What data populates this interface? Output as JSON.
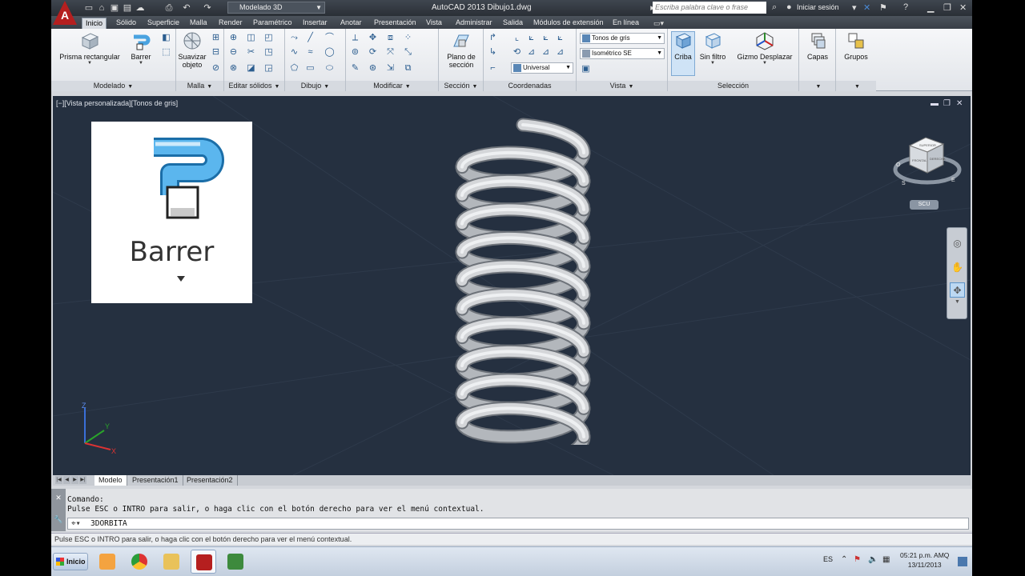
{
  "titlebar": {
    "workspace": "Modelado 3D",
    "title": "AutoCAD 2013    Dibujo1.dwg",
    "search_placeholder": "Escriba palabra clave o frase",
    "signin": "Iniciar sesión",
    "app_letter": "A"
  },
  "tabs": [
    "Inicio",
    "Sólido",
    "Superficie",
    "Malla",
    "Render",
    "Paramétrico",
    "Insertar",
    "Anotar",
    "Presentación",
    "Vista",
    "Administrar",
    "Salida",
    "Módulos de extensión",
    "En línea"
  ],
  "ribbon": {
    "panels": {
      "modelado": "Modelado",
      "malla": "Malla",
      "editar_solidos": "Editar sólidos",
      "dibujo": "Dibujo",
      "modificar": "Modificar",
      "seccion": "Sección",
      "coordenadas": "Coordenadas",
      "vista": "Vista",
      "seleccion": "Selección"
    },
    "buttons": {
      "prisma": "Prisma rectangular",
      "barrer": "Barrer",
      "suavizar": "Suavizar objeto",
      "plano": "Plano de sección",
      "criba": "Criba",
      "sin_filtro": "Sin filtro",
      "gizmo": "Gizmo Desplazar",
      "capas": "Capas",
      "grupos": "Grupos"
    },
    "combos": {
      "visual_style": "Tonos de gris",
      "view": "Isométrico SE",
      "ucs": "Universal"
    }
  },
  "viewport": {
    "label": "[−][Vista personalizada][Tonos de gris]",
    "zoom_label": "Barrer",
    "scu": "SCU",
    "viewcube": {
      "top": "SUPERIOR",
      "front": "FRONTAL",
      "right": "DERECHA",
      "compass_o": "O",
      "compass_s": "S",
      "compass_e": "E"
    },
    "axes": {
      "x": "X",
      "y": "Y",
      "z": "Z"
    }
  },
  "layout_tabs": [
    "Modelo",
    "Presentación1",
    "Presentación2"
  ],
  "command": {
    "history_1": "Comando:",
    "history_2": "Pulse ESC o INTRO para salir, o haga clic con el botón derecho para ver el menú contextual.",
    "current": "3DORBITA"
  },
  "statusbar": {
    "text": "Pulse ESC o INTRO para salir, o haga clic con el botón derecho para ver el menú contextual."
  },
  "taskbar": {
    "start": "Inicio",
    "lang": "ES",
    "time": "05:21 p.m. AMQ",
    "date": "13/11/2013"
  },
  "colors": {
    "viewport_bg": "#253040",
    "accent": "#b51f1f",
    "spring": "#d4d6d9"
  }
}
